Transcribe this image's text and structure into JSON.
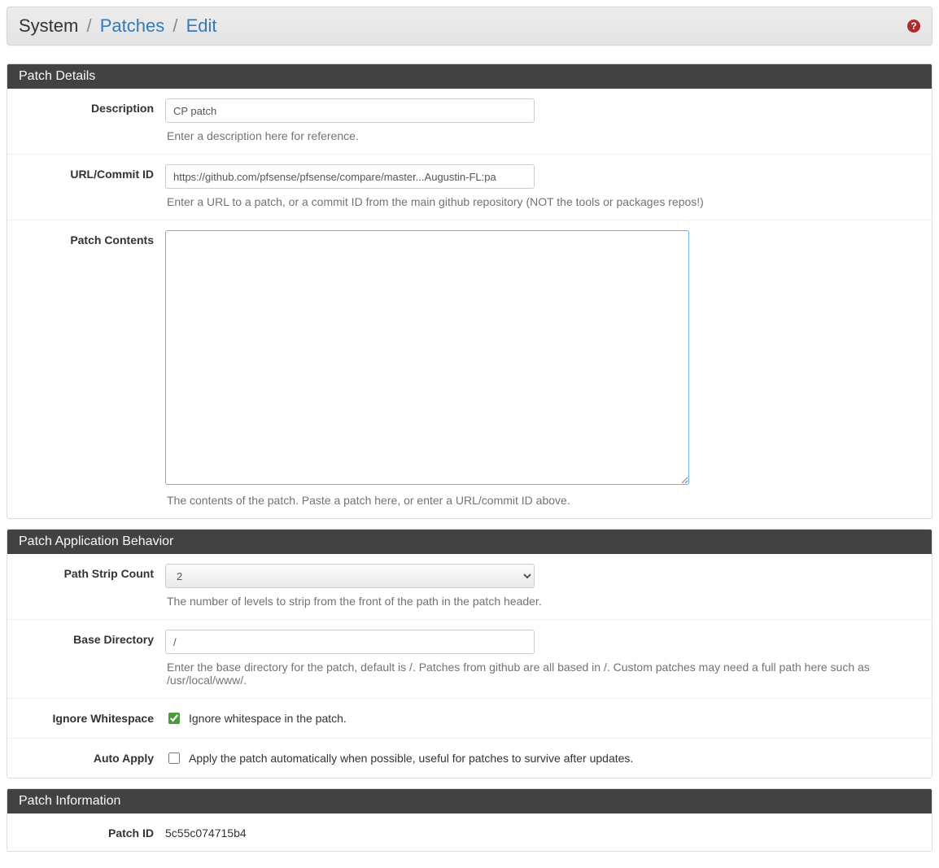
{
  "breadcrumb": {
    "root": "System",
    "mid": "Patches",
    "leaf": "Edit"
  },
  "panels": {
    "details": {
      "title": "Patch Details",
      "description": {
        "label": "Description",
        "value": "CP patch",
        "help": "Enter a description here for reference."
      },
      "url": {
        "label": "URL/Commit ID",
        "value": "https://github.com/pfsense/pfsense/compare/master...Augustin-FL:pa",
        "help": "Enter a URL to a patch, or a commit ID from the main github repository (NOT the tools or packages repos!)"
      },
      "contents": {
        "label": "Patch Contents",
        "value": "",
        "help": "The contents of the patch. Paste a patch here, or enter a URL/commit ID above."
      }
    },
    "behavior": {
      "title": "Patch Application Behavior",
      "strip": {
        "label": "Path Strip Count",
        "value": "2",
        "help": "The number of levels to strip from the front of the path in the patch header."
      },
      "basedir": {
        "label": "Base Directory",
        "value": "/",
        "help": "Enter the base directory for the patch, default is /. Patches from github are all based in /. Custom patches may need a full path here such as /usr/local/www/."
      },
      "ignorews": {
        "label": "Ignore Whitespace",
        "text": "Ignore whitespace in the patch.",
        "checked": true
      },
      "autoapply": {
        "label": "Auto Apply",
        "text": "Apply the patch automatically when possible, useful for patches to survive after updates.",
        "checked": false
      }
    },
    "info": {
      "title": "Patch Information",
      "patchid": {
        "label": "Patch ID",
        "value": "5c55c074715b4"
      }
    }
  }
}
